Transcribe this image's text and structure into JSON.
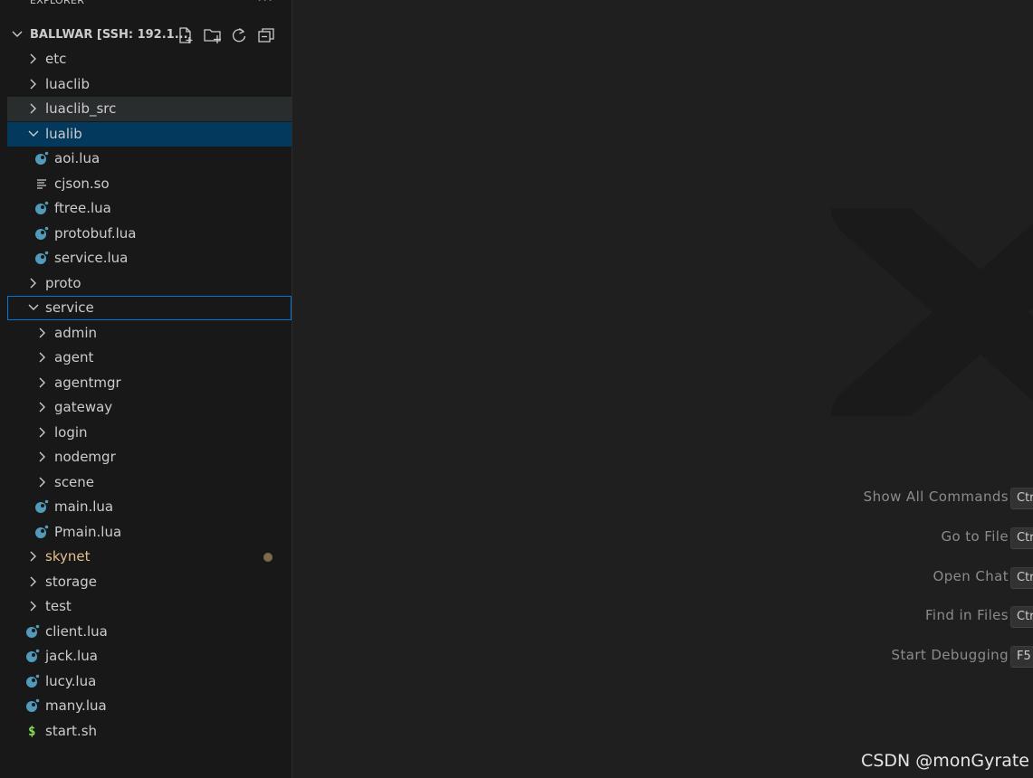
{
  "explorer": {
    "title": "EXPLORER",
    "more_label": "···",
    "root": "BALLWAR [SSH: 192.1...",
    "header_icons": [
      "new-file-icon",
      "new-folder-icon",
      "refresh-icon",
      "collapse-all-icon"
    ]
  },
  "tree": [
    {
      "label": "etc",
      "kind": "folder",
      "expanded": false
    },
    {
      "label": "luaclib",
      "kind": "folder",
      "expanded": false
    },
    {
      "label": "luaclib_src",
      "kind": "folder",
      "expanded": false,
      "state": "hover"
    },
    {
      "label": "lualib",
      "kind": "folder",
      "expanded": true,
      "state": "selected"
    },
    {
      "label": "aoi.lua",
      "kind": "lua-file"
    },
    {
      "label": "cjson.so",
      "kind": "text-file"
    },
    {
      "label": "ftree.lua",
      "kind": "lua-file"
    },
    {
      "label": "protobuf.lua",
      "kind": "lua-file"
    },
    {
      "label": "service.lua",
      "kind": "lua-file"
    },
    {
      "label": "proto",
      "kind": "folder",
      "expanded": false
    },
    {
      "label": "service",
      "kind": "folder",
      "expanded": true,
      "state": "focused"
    },
    {
      "label": "admin",
      "kind": "folder",
      "expanded": false
    },
    {
      "label": "agent",
      "kind": "folder",
      "expanded": false
    },
    {
      "label": "agentmgr",
      "kind": "folder",
      "expanded": false
    },
    {
      "label": "gateway",
      "kind": "folder",
      "expanded": false
    },
    {
      "label": "login",
      "kind": "folder",
      "expanded": false
    },
    {
      "label": "nodemgr",
      "kind": "folder",
      "expanded": false
    },
    {
      "label": "scene",
      "kind": "folder",
      "expanded": false
    },
    {
      "label": "main.lua",
      "kind": "lua-file"
    },
    {
      "label": "Pmain.lua",
      "kind": "lua-file"
    },
    {
      "label": "skynet",
      "kind": "folder",
      "expanded": false,
      "modified": true
    },
    {
      "label": "storage",
      "kind": "folder",
      "expanded": false
    },
    {
      "label": "test",
      "kind": "folder",
      "expanded": false
    },
    {
      "label": "client.lua",
      "kind": "lua-file"
    },
    {
      "label": "jack.lua",
      "kind": "lua-file"
    },
    {
      "label": "lucy.lua",
      "kind": "lua-file"
    },
    {
      "label": "many.lua",
      "kind": "lua-file"
    },
    {
      "label": "start.sh",
      "kind": "shell-file"
    }
  ],
  "commands": [
    {
      "label": "Show All Commands",
      "key": "Ctr"
    },
    {
      "label": "Go to File",
      "key": "Ctr"
    },
    {
      "label": "Open Chat",
      "key": "Ctr"
    },
    {
      "label": "Find in Files",
      "key": "Ctr"
    },
    {
      "label": "Start Debugging",
      "key": "F5"
    }
  ],
  "watermark_text": "CSDN @monGyrate",
  "colors": {
    "sidebar_bg": "#181818",
    "editor_bg": "#1f1f1f",
    "selection": "#04395e",
    "focus_border": "#0078d4",
    "lua_icon": "#519aba",
    "shell_icon": "#89e051",
    "modified": "#e2c08d"
  }
}
